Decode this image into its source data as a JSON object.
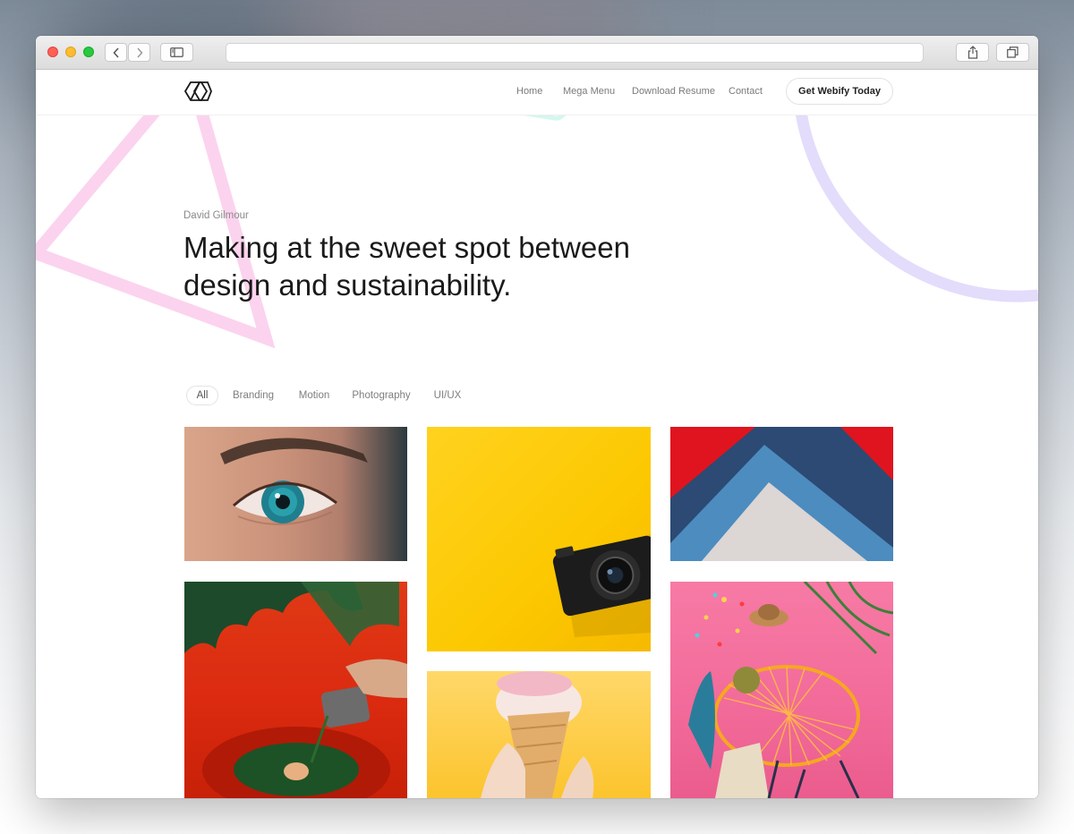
{
  "browser": {
    "address": ""
  },
  "nav": {
    "links": [
      "Home",
      "Mega Menu",
      "Download Resume",
      "Contact"
    ],
    "cta": "Get Webify Today"
  },
  "hero": {
    "author": "David Gilmour",
    "headline_line1": "Making at the sweet spot between",
    "headline_line2": "design and sustainability."
  },
  "filters": {
    "items": [
      "All",
      "Branding",
      "Motion",
      "Photography",
      "UI/UX"
    ],
    "active": "All"
  },
  "portfolio": {
    "items": [
      {
        "subject": "eye-closeup-photo"
      },
      {
        "subject": "camera-on-yellow-photo"
      },
      {
        "subject": "red-blue-paper-shapes-photo"
      },
      {
        "subject": "pouring-green-sauce-photo"
      },
      {
        "subject": "ice-cream-cone-photo"
      },
      {
        "subject": "pink-chair-beach-photo"
      }
    ]
  },
  "colors": {
    "accent_pink": "#fbd3ee",
    "accent_mint": "#d4f7ee",
    "accent_lavender": "#e3dcfb",
    "text_dark": "#1a1a1a"
  }
}
